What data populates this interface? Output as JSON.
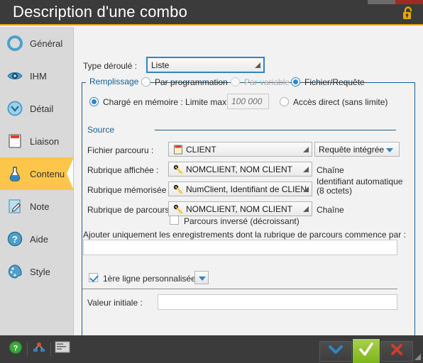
{
  "window": {
    "title": "Description d'une combo",
    "lock_icon": "unlocked-padlock-icon",
    "accent": "#e8a800",
    "titlebar_bg": "#3b3b3b"
  },
  "sidebar": {
    "items": [
      {
        "label": "Général",
        "icon": "ring-icon",
        "active": false
      },
      {
        "label": "IHM",
        "icon": "eye-icon",
        "active": false
      },
      {
        "label": "Détail",
        "icon": "clock-icon",
        "active": false
      },
      {
        "label": "Liaison",
        "icon": "card-icon",
        "active": false
      },
      {
        "label": "Contenu",
        "icon": "flask-icon",
        "active": true
      },
      {
        "label": "Note",
        "icon": "note-icon",
        "active": false
      },
      {
        "label": "Aide",
        "icon": "question-icon",
        "active": false
      },
      {
        "label": "Style",
        "icon": "palette-icon",
        "active": false
      }
    ]
  },
  "form": {
    "type_label": "Type déroulé :",
    "type_value": "Liste",
    "remplissage": {
      "legend": "Remplissage :",
      "options": [
        {
          "label": "Par programmation",
          "selected": false,
          "disabled": false
        },
        {
          "label": "Par variable",
          "selected": false,
          "disabled": true
        },
        {
          "label": "Fichier/Requête",
          "selected": true,
          "disabled": false
        }
      ],
      "memory_option": "Chargé en mémoire : Limite max :",
      "memory_selected": true,
      "limit_value": "100 000",
      "direct_option": "Accès direct (sans limite)",
      "direct_selected": false
    },
    "source": {
      "legend": "Source",
      "rows": [
        {
          "label": "Fichier parcouru :",
          "value": "CLIENT",
          "icon": "file-icon",
          "suffix": "",
          "extra_combo": "Requête intégrée"
        },
        {
          "label": "Rubrique affichée :",
          "value": "NOMCLIENT, NOM CLIENT",
          "icon": "key-icon",
          "suffix": "Chaîne"
        },
        {
          "label": "Rubrique mémorisée :",
          "value": "NumClient, Identifiant de CLIEN",
          "icon": "key-icon",
          "suffix": "Identifiant automatique\n(8 octets)"
        },
        {
          "label": "Rubrique de parcours :",
          "value": "NOMCLIENT, NOM CLIENT",
          "icon": "key-icon",
          "suffix": "Chaîne"
        }
      ],
      "reverse_checkbox": "Parcours inversé (décroissant)",
      "reverse_checked": false
    },
    "filter_label": "Ajouter uniquement les enregistrements dont la rubrique de parcours commence par :",
    "filter_value": "",
    "first_line_checkbox": "1ère ligne personnalisée",
    "first_line_checked": true,
    "initial_label": "Valeur initiale :",
    "initial_value": ""
  },
  "bottombar": {
    "help_icon": "help-question-icon",
    "tree_icon": "hierarchy-icon",
    "code_icon": "code-window-icon",
    "dropdown_icon": "chevron-down-icon",
    "ok_icon": "check-icon",
    "cancel_icon": "cross-icon",
    "resize_grip": "resize-grip-icon"
  }
}
